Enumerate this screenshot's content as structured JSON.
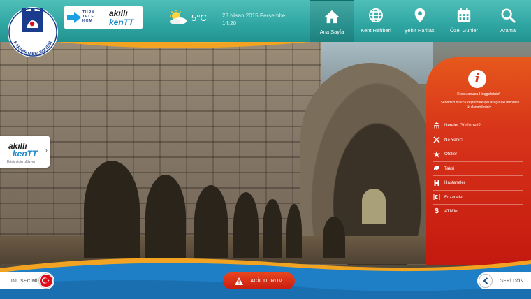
{
  "logo": {
    "text": "KARAMAN BELEDİYESİ"
  },
  "partners": {
    "telekom_words": [
      "TÜRK",
      "TELE",
      "KOM"
    ],
    "akilli_line1": "akıllı",
    "akilli_line2": "kenTT"
  },
  "weather": {
    "temperature": "5°C",
    "icon": "partly-cloudy-icon"
  },
  "datetime": {
    "date": "23 Nisan 2015 Perşembe",
    "time": "14:20"
  },
  "nav": [
    {
      "label": "Ana Sayfa",
      "icon": "home-icon",
      "active": true
    },
    {
      "label": "Kent Rehberi",
      "icon": "globe-icon",
      "active": false
    },
    {
      "label": "Şehir Haritası",
      "icon": "map-pin-icon",
      "active": false
    },
    {
      "label": "Özel Günler",
      "icon": "calendar-icon",
      "active": false
    },
    {
      "label": "Arama",
      "icon": "search-icon",
      "active": false
    }
  ],
  "side_badge": {
    "line1": "akıllı",
    "line2": "kenTT",
    "hint": "Erişim için tıklayın"
  },
  "panel": {
    "welcome": "Kioskumuza Hoşgeldiniz!",
    "subtitle": "Şehrimizi hızlıca keşfetmek için aşağıdaki menüleri kullanabilirsiniz.",
    "items": [
      {
        "label": "Nereler Görülmeli?",
        "icon": "landmark-icon"
      },
      {
        "label": "Ne Yenir?",
        "icon": "fork-knife-icon"
      },
      {
        "label": "Oteller",
        "icon": "star-icon"
      },
      {
        "label": "Taksi",
        "icon": "taxi-icon"
      },
      {
        "label": "Hastaneler",
        "icon": "hospital-icon"
      },
      {
        "label": "Eczaneler",
        "icon": "pharmacy-icon"
      },
      {
        "label": "ATM'ler",
        "icon": "dollar-icon"
      }
    ]
  },
  "bottom": {
    "language_label": "DİL SEÇİMİ",
    "emergency_label": "ACİL DURUM",
    "back_label": "GERİ DÖN"
  },
  "colors": {
    "topbar": "#2fa5a2",
    "panel": "#d8341a",
    "bottom": "#1f7fc6",
    "accent_orange": "#f2a321"
  }
}
